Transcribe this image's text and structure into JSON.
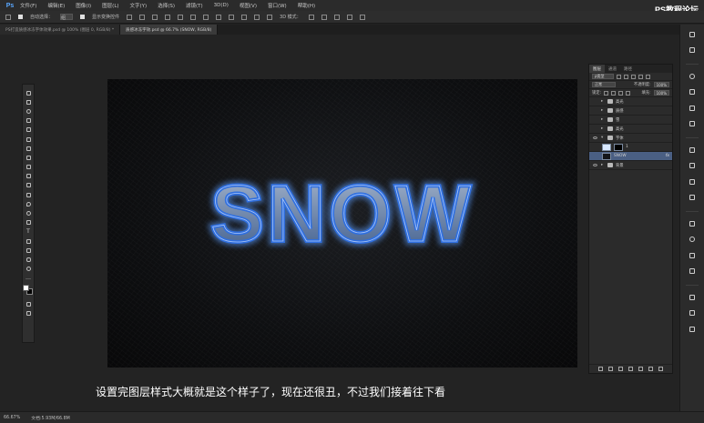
{
  "app": {
    "logo": "Ps",
    "menus": [
      "文件(F)",
      "编辑(E)",
      "图像(I)",
      "图层(L)",
      "文字(Y)",
      "选择(S)",
      "滤镜(T)",
      "3D(D)",
      "视图(V)",
      "窗口(W)",
      "帮助(H)"
    ],
    "watermark": "PS教程论坛"
  },
  "options_bar": {
    "auto_select_label": "自动选择：",
    "auto_select_value": "组",
    "transform_label": "显示变换控件",
    "mode_label": "3D 模式："
  },
  "tabs": [
    {
      "label": "PS打造质感冰冻字体效果.psd @ 100% (图层 0, RGB/8) *",
      "active": false
    },
    {
      "label": "质感冰冻字效.psd @ 66.7% (SNOW, RGB/8)",
      "active": true
    }
  ],
  "canvas": {
    "text": "SNOW",
    "colors": {
      "fill_top": "#a8b8ce",
      "fill_bottom": "#3e5c8c",
      "outline": "#2f6fe0",
      "glow": "#5b9dff"
    }
  },
  "caption": "设置完图层样式大概就是这个样子了，现在还很丑，不过我们接着往下看",
  "status": {
    "zoom": "66.67%",
    "doc_info": "文档:5.93M/66.8M"
  },
  "layers_panel": {
    "tabs": [
      "图层",
      "通道",
      "路径"
    ],
    "kind_label": "ρ类型",
    "blend_mode": "正常",
    "opacity_label": "不透明度:",
    "opacity_value": "100%",
    "lock_label": "锁定:",
    "fill_label": "填充:",
    "fill_value": "100%",
    "layers": [
      {
        "name": "高光",
        "type": "group",
        "visible": false
      },
      {
        "name": "质感",
        "type": "group",
        "visible": false
      },
      {
        "name": "雪",
        "type": "group",
        "visible": false
      },
      {
        "name": "高光",
        "type": "group",
        "visible": false
      },
      {
        "name": "字体",
        "type": "group",
        "visible": true
      },
      {
        "name": "1",
        "type": "layer",
        "visible": false
      },
      {
        "name": "SNOW",
        "type": "text",
        "visible": false,
        "selected": true,
        "fx": "fx"
      },
      {
        "name": "背景",
        "type": "group",
        "visible": true
      }
    ]
  }
}
